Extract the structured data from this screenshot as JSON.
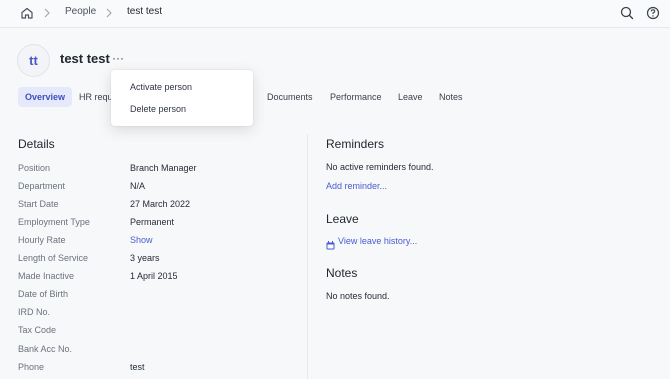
{
  "breadcrumb": {
    "home_icon": "home-icon",
    "items": [
      "People",
      "test test"
    ]
  },
  "header_icons": [
    "search-icon",
    "help-icon"
  ],
  "person": {
    "initials": "tt",
    "name": "test test",
    "more_label": "···"
  },
  "tabs": [
    {
      "label": "Overview",
      "active": true
    },
    {
      "label": "HR requ"
    },
    {
      "label": "Documents"
    },
    {
      "label": "Performance"
    },
    {
      "label": "Leave"
    },
    {
      "label": "Notes"
    }
  ],
  "dropdown": {
    "items": [
      "Activate person",
      "Delete person"
    ]
  },
  "details": {
    "title": "Details",
    "rows": [
      {
        "label": "Position",
        "value": "Branch Manager"
      },
      {
        "label": "Department",
        "value": "N/A"
      },
      {
        "label": "Start Date",
        "value": "27 March 2022"
      },
      {
        "label": "Employment Type",
        "value": "Permanent"
      },
      {
        "label": "Hourly Rate",
        "value": "Show"
      },
      {
        "label": "Length of Service",
        "value": "3 years"
      },
      {
        "label": "Made Inactive",
        "value": "1 April 2015"
      },
      {
        "label": "Date of Birth",
        "value": ""
      },
      {
        "label": "IRD No.",
        "value": ""
      },
      {
        "label": "Tax Code",
        "value": ""
      },
      {
        "label": "Bank Acc No.",
        "value": ""
      },
      {
        "label": "Phone",
        "value": "test"
      }
    ]
  },
  "reminders": {
    "title": "Reminders",
    "empty_text": "No active reminders found.",
    "add_link": "Add reminder..."
  },
  "leave": {
    "title": "Leave",
    "history_link": "View leave history..."
  },
  "notes": {
    "title": "Notes",
    "empty_text": "No notes found."
  },
  "colors": {
    "accent": "#4a5bd0",
    "active_tab_bg": "#e6e9fb",
    "page_bg": "#f7f8fa"
  }
}
